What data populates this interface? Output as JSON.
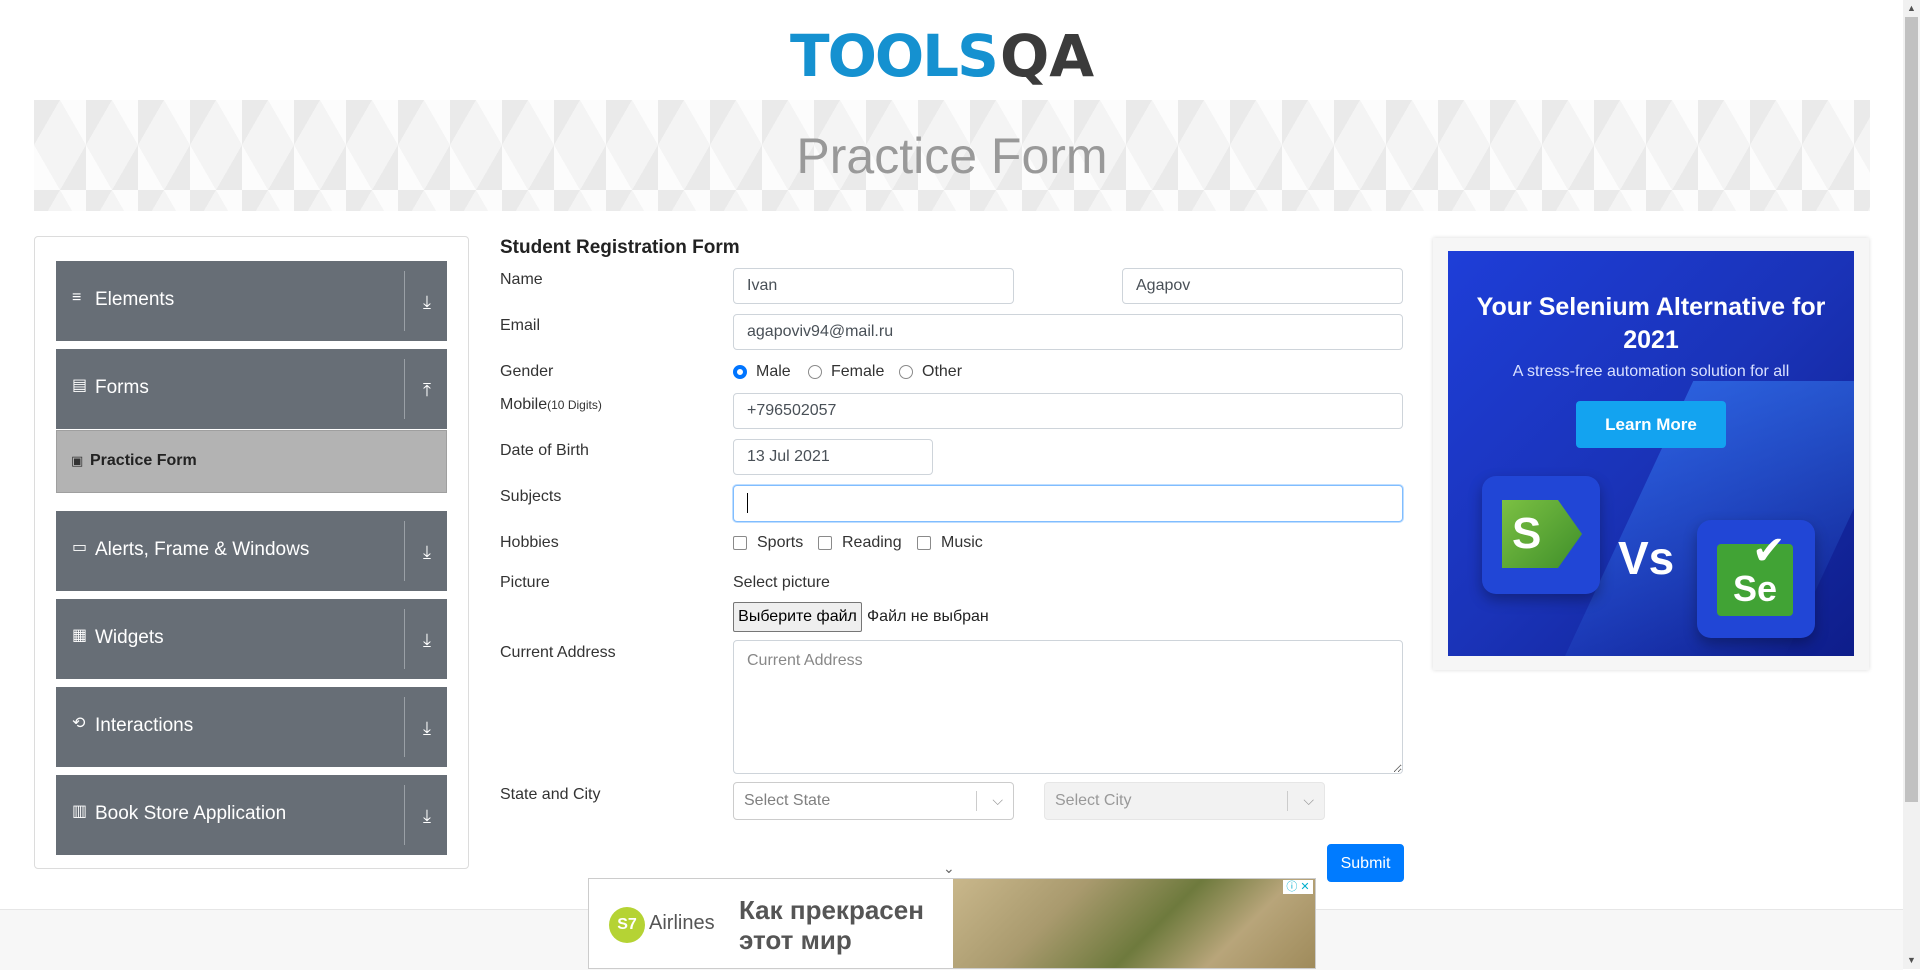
{
  "logo": {
    "tools": "TOOLS",
    "qa": "QA"
  },
  "banner": {
    "title": "Practice Form"
  },
  "sidebar": {
    "groups": [
      {
        "label": "Elements",
        "icon": "≡",
        "arrow": "⤓"
      },
      {
        "label": "Forms",
        "icon": "▤",
        "arrow": "⤒"
      },
      {
        "label": "Alerts, Frame & Windows",
        "icon": "▭",
        "arrow": "⤓"
      },
      {
        "label": "Widgets",
        "icon": "▦",
        "arrow": "⤓"
      },
      {
        "label": "Interactions",
        "icon": "⟲",
        "arrow": "⤓"
      },
      {
        "label": "Book Store Application",
        "icon": "▥",
        "arrow": "⤓"
      }
    ],
    "active_sub": {
      "label": "Practice Form",
      "icon": "▣"
    }
  },
  "form": {
    "title": "Student Registration Form",
    "labels": {
      "name": "Name",
      "email": "Email",
      "gender": "Gender",
      "mobile": "Mobile",
      "mobile_hint": "(10 Digits)",
      "dob": "Date of Birth",
      "subjects": "Subjects",
      "hobbies": "Hobbies",
      "picture": "Picture",
      "address": "Current Address",
      "state_city": "State and City"
    },
    "first_name": "Ivan",
    "last_name": "Agapov",
    "email": "agapoviv94@mail.ru",
    "gender_options": [
      "Male",
      "Female",
      "Other"
    ],
    "gender_selected": "Male",
    "mobile": "+796502057",
    "dob": "13 Jul 2021",
    "subjects": "",
    "hobbies": [
      "Sports",
      "Reading",
      "Music"
    ],
    "picture_label": "Select picture",
    "file_button": "Выберите файл",
    "file_status": "Файл не выбран",
    "address_placeholder": "Current Address",
    "state_placeholder": "Select State",
    "city_placeholder": "Select City",
    "submit": "Submit"
  },
  "ad_right": {
    "headline": "Your Selenium Alternative for 2021",
    "subline": "A stress-free automation solution for all",
    "cta": "Learn More",
    "left_logo": "S",
    "vs": "Vs",
    "right_logo": "Se"
  },
  "ad_bottom": {
    "brand_mark": "S7",
    "brand": "Airlines",
    "text_line1": "Как прекрасен",
    "text_line2": "этот мир",
    "adchoices": "ⓘ ✕"
  }
}
